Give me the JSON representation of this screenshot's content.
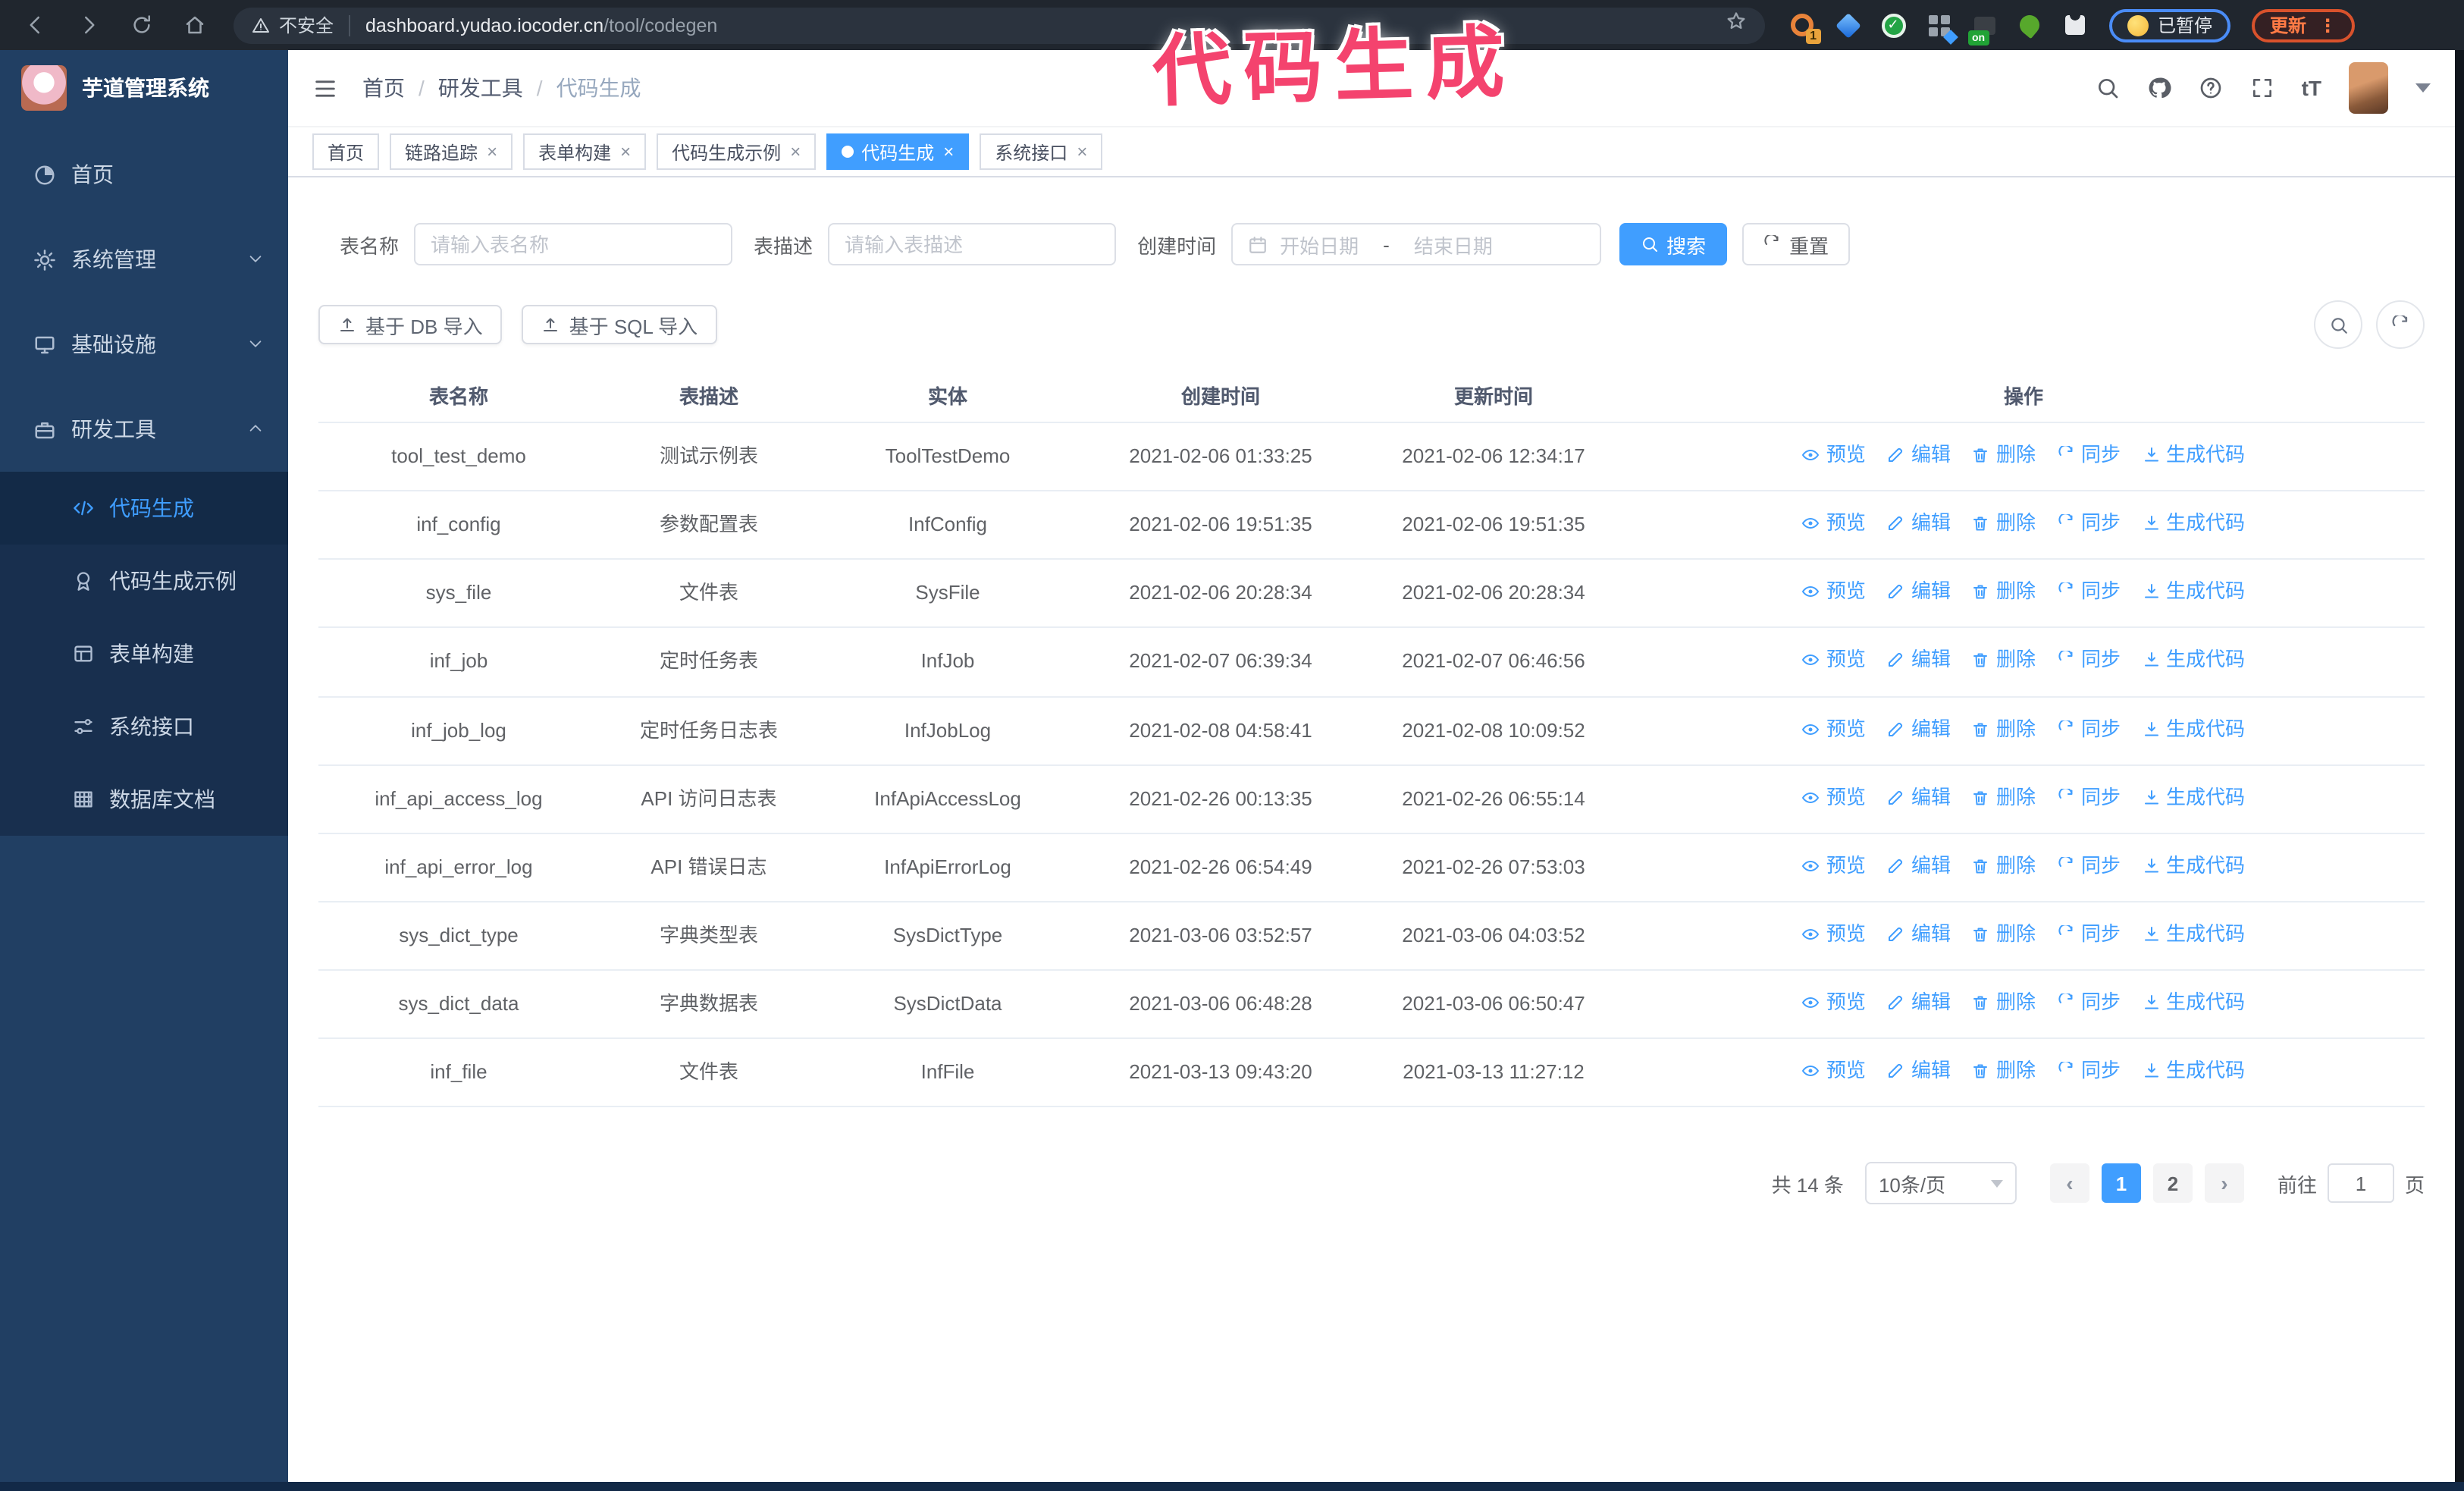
{
  "browser": {
    "security_label": "不安全",
    "url_domain": "dashboard.yudao.iocoder.cn",
    "url_path": "/tool/codegen",
    "ext_badge_count": "1",
    "ext_badge_on": "on",
    "paused_label": "已暂停",
    "update_label": "更新"
  },
  "annotation": {
    "text": "代码生成"
  },
  "colors": {
    "accent": "#409eff",
    "sidebar_bg": "#213f63",
    "submenu_bg": "#182f4e",
    "annotation_pink": "#f4436e",
    "update_orange": "#ff7a45",
    "paused_border_blue": "#4a8cf7",
    "toolbar_bg": "#20262e"
  },
  "sidebar": {
    "logo_title": "芋道管理系统",
    "menu": [
      "首页",
      "系统管理",
      "基础设施",
      "研发工具"
    ],
    "submenu": [
      "代码生成",
      "代码生成示例",
      "表单构建",
      "系统接口",
      "数据库文档"
    ]
  },
  "header": {
    "breadcrumb": [
      "首页",
      "研发工具",
      "代码生成"
    ]
  },
  "tabs": [
    "首页",
    "链路追踪",
    "表单构建",
    "代码生成示例",
    "代码生成",
    "系统接口"
  ],
  "filters": {
    "name_label": "表名称",
    "name_placeholder": "请输入表名称",
    "desc_label": "表描述",
    "desc_placeholder": "请输入表描述",
    "time_label": "创建时间",
    "start_placeholder": "开始日期",
    "range_separator": "-",
    "end_placeholder": "结束日期",
    "search_label": "搜索",
    "reset_label": "重置"
  },
  "toolbar": {
    "import_db_label": "基于 DB 导入",
    "import_sql_label": "基于 SQL 导入"
  },
  "table": {
    "columns": [
      "表名称",
      "表描述",
      "实体",
      "创建时间",
      "更新时间",
      "操作"
    ],
    "actions": [
      "预览",
      "编辑",
      "删除",
      "同步",
      "生成代码"
    ],
    "rows": [
      {
        "name": "tool_test_demo",
        "desc": "测试示例表",
        "entity": "ToolTestDemo",
        "created": "2021-02-06 01:33:25",
        "updated": "2021-02-06 12:34:17"
      },
      {
        "name": "inf_config",
        "desc": "参数配置表",
        "entity": "InfConfig",
        "created": "2021-02-06 19:51:35",
        "updated": "2021-02-06 19:51:35"
      },
      {
        "name": "sys_file",
        "desc": "文件表",
        "entity": "SysFile",
        "created": "2021-02-06 20:28:34",
        "updated": "2021-02-06 20:28:34"
      },
      {
        "name": "inf_job",
        "desc": "定时任务表",
        "entity": "InfJob",
        "created": "2021-02-07 06:39:34",
        "updated": "2021-02-07 06:46:56"
      },
      {
        "name": "inf_job_log",
        "desc": "定时任务日志表",
        "entity": "InfJobLog",
        "created": "2021-02-08 04:58:41",
        "updated": "2021-02-08 10:09:52"
      },
      {
        "name": "inf_api_access_log",
        "desc": "API 访问日志表",
        "entity": "InfApiAccessLog",
        "created": "2021-02-26 00:13:35",
        "updated": "2021-02-26 06:55:14"
      },
      {
        "name": "inf_api_error_log",
        "desc": "API 错误日志",
        "entity": "InfApiErrorLog",
        "created": "2021-02-26 06:54:49",
        "updated": "2021-02-26 07:53:03"
      },
      {
        "name": "sys_dict_type",
        "desc": "字典类型表",
        "entity": "SysDictType",
        "created": "2021-03-06 03:52:57",
        "updated": "2021-03-06 04:03:52"
      },
      {
        "name": "sys_dict_data",
        "desc": "字典数据表",
        "entity": "SysDictData",
        "created": "2021-03-06 06:48:28",
        "updated": "2021-03-06 06:50:47"
      },
      {
        "name": "inf_file",
        "desc": "文件表",
        "entity": "InfFile",
        "created": "2021-03-13 09:43:20",
        "updated": "2021-03-13 11:27:12"
      }
    ]
  },
  "pagination": {
    "total_label": "共 14 条",
    "page_size_label": "10条/页",
    "pages": [
      "1",
      "2"
    ],
    "goto_label": "前往",
    "goto_value": "1",
    "unit_label": "页"
  }
}
